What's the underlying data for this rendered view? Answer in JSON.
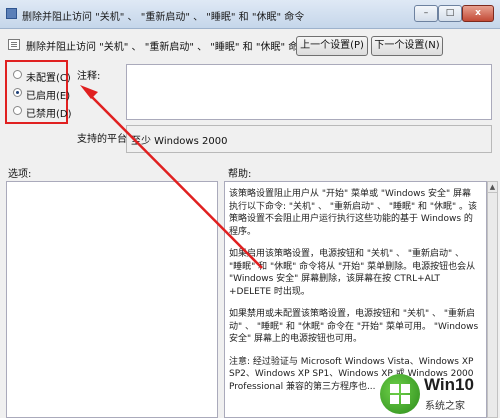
{
  "window": {
    "title": "删除并阻止访问 \"关机\" 、 \"重新启动\" 、 \"睡眠\" 和 \"休眠\" 命令",
    "controls": {
      "minimize": "–",
      "maximize": "□",
      "close": "x"
    }
  },
  "header": {
    "policy_title": "删除并阻止访问 \"关机\" 、 \"重新启动\" 、 \"睡眠\" 和 \"休眠\" 命令",
    "prev_button": "上一个设置(P)",
    "next_button": "下一个设置(N)"
  },
  "options": [
    {
      "label": "未配置(C)",
      "checked": false
    },
    {
      "label": "已启用(E)",
      "checked": true
    },
    {
      "label": "已禁用(D)",
      "checked": false
    }
  ],
  "comment": {
    "label": "注释:",
    "value": ""
  },
  "support": {
    "label": "支持的平台:",
    "value": "至少 Windows 2000"
  },
  "sections": {
    "options_label": "选项:",
    "help_label": "帮助:"
  },
  "help_paragraphs": [
    "该策略设置阻止用户从 \"开始\" 菜单或 \"Windows 安全\" 屏幕执行以下命令: \"关机\" 、 \"重新启动\" 、 \"睡眠\" 和 \"休眠\" 。该策略设置不会阻止用户运行执行这些功能的基于 Windows 的程序。",
    "如果启用该策略设置，电源按钮和 \"关机\" 、 \"重新启动\" 、 \"睡眠\" 和 \"休眠\" 命令将从 \"开始\" 菜单删除。电源按钮也会从 \"Windows 安全\" 屏幕删除，该屏幕在按 CTRL+ALT +DELETE 时出现。",
    "如果禁用或未配置该策略设置，电源按钮和 \"关机\" 、 \"重新启动\" 、 \"睡眠\" 和 \"休眠\" 命令在 \"开始\" 菜单可用。 \"Windows 安全\" 屏幕上的电源按钮也可用。",
    "注意: 经过验证与 Microsoft Windows Vista、Windows XP SP2、Windows XP SP1、Windows XP 或 Windows 2000 Professional 兼容的第三方程序也..."
  ],
  "watermark": {
    "title": "Win10",
    "subtitle": "系统之家"
  },
  "colors": {
    "highlight_red": "#e02020",
    "title_gradient_top": "#dfe9f5"
  },
  "icons": {
    "title": "group-policy-icon",
    "policy": "policy-setting-icon",
    "watermark": "windows-logo-icon"
  }
}
